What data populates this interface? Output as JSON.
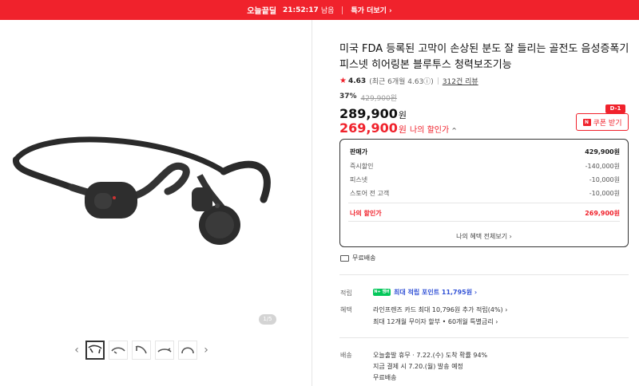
{
  "topbar": {
    "brand": "오늘끝딜",
    "timer": "21:52:17",
    "timer_suffix": "남음",
    "more": "특가 더보기 ›"
  },
  "gallery": {
    "pager": "1/5",
    "prev_arrow": "‹",
    "next_arrow": "›",
    "thumbnails": 5
  },
  "product": {
    "title": "미국 FDA 등록된 고막이 손상된 분도 잘 들리는 골전도 음성증폭기 피스넷 히어링본 블루투스 청력보조기능",
    "rating": "4.63",
    "rating_sub": "(최근 6개월 4.63ⓘ)",
    "reviews": "312건 리뷰",
    "discount_pct": "37%",
    "original_price": "429,900원",
    "price": "289,900",
    "my_price": "269,900",
    "won": "원",
    "my_price_label": "나의 할인가",
    "my_price_chev": "^"
  },
  "coupon": {
    "badge": "D-1",
    "icon": "N",
    "label": "쿠폰 받기"
  },
  "pricebox": {
    "rows": [
      {
        "label": "판매가",
        "value": "429,900원"
      },
      {
        "label": "즉시할인",
        "value": "-140,000원"
      },
      {
        "label": "피스넷",
        "value": "-10,000원"
      },
      {
        "label": "스토어 전 고객",
        "value": "-10,000원"
      }
    ],
    "my_label": "나의 할인가",
    "my_value": "269,900원",
    "benefits": "나의 혜택 전체보기 ›"
  },
  "shipping_free": "무료배송",
  "info": {
    "points_label": "적립",
    "npay": "N+ 멤버십",
    "points_text": "최대 적립 포인트 11,795원 ›",
    "benefit_label": "혜택",
    "benefit_line1": "라인프렌즈 카드 최대 10,796원 추가 적립(4%) ›",
    "benefit_line2": "최대 12개월 무이자 할부 • 60개월 특별금리 ›",
    "delivery_label": "배송",
    "delivery_line1": "오늘출발 휴무 · 7.22.(수) 도착 확률 94%",
    "delivery_line2": "지금 결제 시 7.20.(월) 발송 예정",
    "delivery_line3": "무료배송"
  },
  "colors": {
    "accent": "#f0222c",
    "points": "#3353d6"
  }
}
